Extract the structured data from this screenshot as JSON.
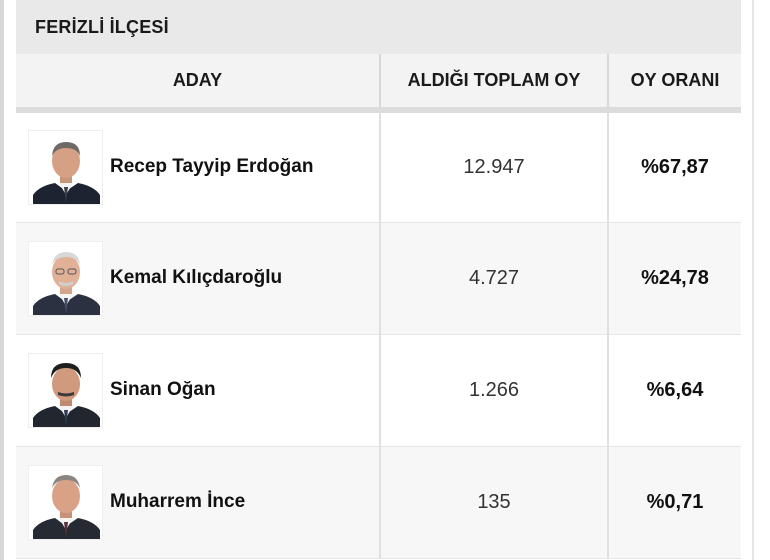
{
  "district": {
    "title": "FERİZLİ İLÇESİ"
  },
  "table": {
    "headers": {
      "candidate": "ADAY",
      "votes": "ALDIĞI TOPLAM OY",
      "rate": "OY ORANI"
    },
    "rows": [
      {
        "name": "Recep Tayyip Erdoğan",
        "votes": "12.947",
        "rate": "%67,87"
      },
      {
        "name": "Kemal Kılıçdaroğlu",
        "votes": "4.727",
        "rate": "%24,78"
      },
      {
        "name": "Sinan Oğan",
        "votes": "1.266",
        "rate": "%6,64"
      },
      {
        "name": "Muharrem İnce",
        "votes": "135",
        "rate": "%0,71"
      }
    ]
  },
  "colors": {
    "header_bg": "#e9e9e9",
    "thead_bg": "#f3f3f3",
    "row_alt_bg": "#f7f7f7",
    "text": "#111111"
  }
}
